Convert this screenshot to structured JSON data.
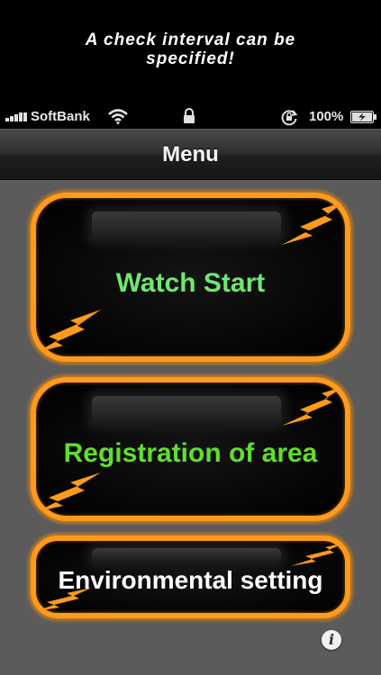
{
  "caption": {
    "line1": "A check interval can be",
    "line2": "specified!"
  },
  "status_bar": {
    "carrier": "SoftBank",
    "battery_percent": "100%",
    "icons": [
      "signal-icon",
      "wifi-icon",
      "lock-icon",
      "rotation-lock-icon",
      "battery-charging-icon"
    ]
  },
  "nav": {
    "title": "Menu"
  },
  "menu": {
    "watch_start": "Watch Start",
    "registration": "Registration of area",
    "environmental": "Environmental setting"
  },
  "info_button": {
    "glyph": "i"
  },
  "colors": {
    "button_border": "#ff9a1a",
    "watch_label": "#6ee86e",
    "registration_label": "#5fe02a",
    "environmental_label": "#ffffff",
    "content_background": "#5b5b5b"
  }
}
